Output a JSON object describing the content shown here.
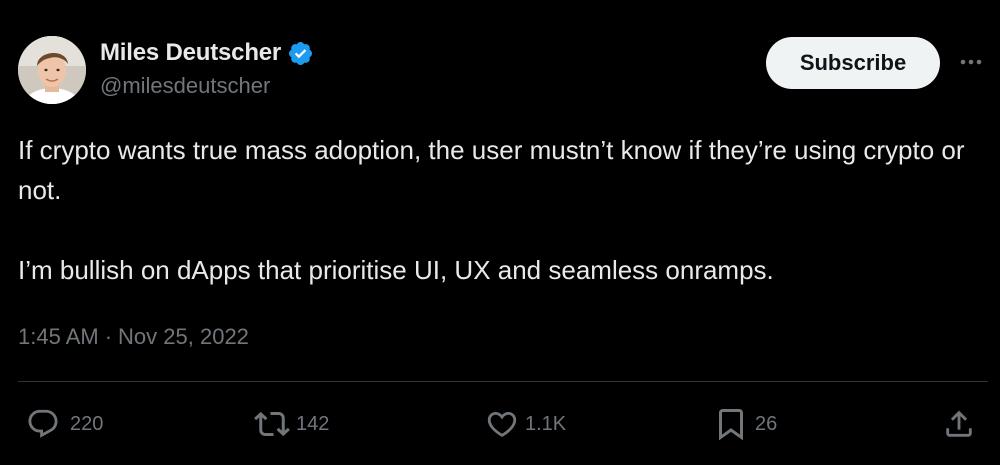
{
  "tweet": {
    "author": {
      "name": "Miles Deutscher",
      "handle": "@milesdeutscher",
      "verified": true
    },
    "subscribe_label": "Subscribe",
    "text_paragraphs": [
      "If crypto wants true mass adoption, the user mustn’t know if they’re using crypto or not.",
      "I’m bullish on dApps that prioritise UI, UX and seamless onramps."
    ],
    "time": "1:45 AM",
    "separator": "·",
    "date": "Nov 25, 2022",
    "actions": {
      "replies": "220",
      "reposts": "142",
      "likes": "1.1K",
      "bookmarks": "26"
    }
  },
  "colors": {
    "background": "#000000",
    "primary_text": "#e7e9ea",
    "secondary_text": "#71767b",
    "verified_badge": "#1d9bf0",
    "subscribe_bg": "#eff3f4",
    "divider": "#2f3336"
  },
  "icons": {
    "verified": "verified-badge-icon",
    "more": "more-options-icon",
    "reply": "reply-icon",
    "repost": "repost-icon",
    "like": "heart-icon",
    "bookmark": "bookmark-icon",
    "share": "share-icon"
  }
}
